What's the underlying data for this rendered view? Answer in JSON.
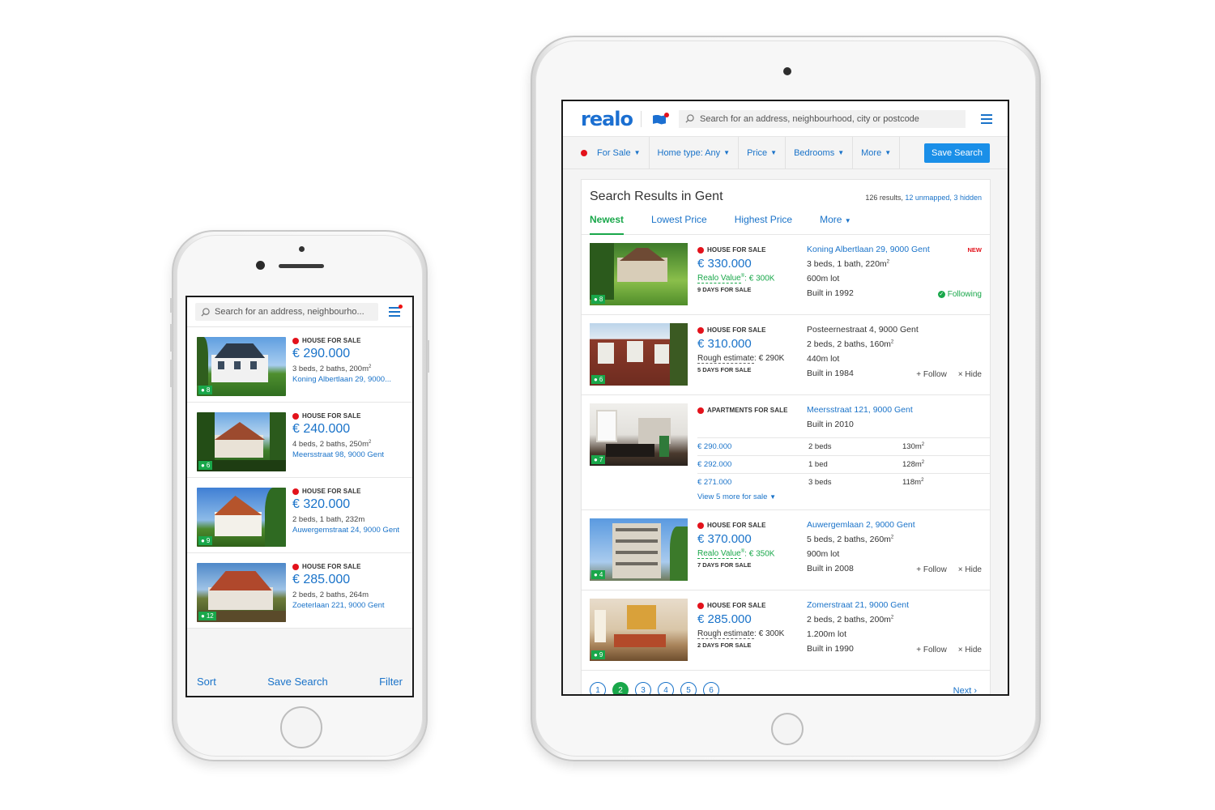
{
  "colors": {
    "brand": "#1a73c9",
    "green": "#19a74a",
    "red": "#e3121b"
  },
  "phone": {
    "search_placeholder": "Search for an address, neighbourho...",
    "listings": [
      {
        "type": "HOUSE FOR SALE",
        "price": "€ 290.000",
        "meta": "3 beds, 2 baths, 200m",
        "address": "Koning Albertlaan 29, 9000...",
        "photos": "8"
      },
      {
        "type": "HOUSE FOR SALE",
        "price": "€ 240.000",
        "meta": "4 beds, 2 baths, 250m",
        "address": "Meersstraat 98, 9000 Gent",
        "photos": "6"
      },
      {
        "type": "HOUSE FOR SALE",
        "price": "€ 320.000",
        "meta": "2 beds, 1 bath, 232m",
        "address": "Auwergemstraat 24, 9000 Gent",
        "photos": "9"
      },
      {
        "type": "HOUSE FOR SALE",
        "price": "€ 285.000",
        "meta": "2 beds, 2 baths, 264m",
        "address": "Zoeterlaan 221, 9000 Gent",
        "photos": "12"
      }
    ],
    "bottom": {
      "sort": "Sort",
      "save": "Save Search",
      "filter": "Filter"
    }
  },
  "tablet": {
    "logo": "realo",
    "search_placeholder": "Search for an address, neighbourhood, city or postcode",
    "filters": {
      "for_sale": "For Sale",
      "home_type": "Home type: Any",
      "price": "Price",
      "bedrooms": "Bedrooms",
      "more": "More"
    },
    "save_search": "Save Search",
    "title": "Search Results in Gent",
    "count": {
      "results": "126 results,",
      "unmapped": "12 unmapped,",
      "hidden": "3 hidden"
    },
    "tabs": {
      "newest": "Newest",
      "lowest": "Lowest Price",
      "highest": "Highest Price",
      "more": "More"
    },
    "listings": [
      {
        "type": "HOUSE FOR SALE",
        "price": "€ 330.000",
        "value_label": "Realo Value",
        "value_rest": ": € 300K",
        "days": "9 DAYS FOR SALE",
        "address": "Koning Albertlaan 29, 9000 Gent",
        "l1": "3 beds, 1 bath, 220m",
        "l2": "600m lot",
        "l3": "Built in 1992",
        "badge": "NEW",
        "following": "Following",
        "photos": "8"
      },
      {
        "type": "HOUSE FOR SALE",
        "price": "€ 310.000",
        "value_label": "Rough estimate",
        "value_rest": ": € 290K",
        "days": "5 DAYS FOR SALE",
        "address": "Posteernestraat 4, 9000 Gent",
        "l1": "2 beds, 2 baths, 160m",
        "l2": "440m lot",
        "l3": "Built in 1984",
        "follow": "Follow",
        "hide": "Hide",
        "photos": "6"
      },
      {
        "type": "HOUSE FOR SALE",
        "price": "€ 370.000",
        "value_label": "Realo Value",
        "value_rest": ": € 350K",
        "days": "7 DAYS FOR SALE",
        "address": "Auwergemlaan 2, 9000 Gent",
        "l1": "5 beds, 2 baths, 260m",
        "l2": "900m lot",
        "l3": "Built in 2008",
        "follow": "Follow",
        "hide": "Hide",
        "photos": "4"
      },
      {
        "type": "HOUSE FOR SALE",
        "price": "€ 285.000",
        "value_label": "Rough estimate",
        "value_rest": ": € 300K",
        "days": "2 DAYS FOR SALE",
        "address": "Zomerstraat 21, 9000 Gent",
        "l1": "2 beds, 2 baths, 200m",
        "l2": "1.200m lot",
        "l3": "Built in 1990",
        "follow": "Follow",
        "hide": "Hide",
        "photos": "9"
      }
    ],
    "apartment": {
      "type": "APARTMENTS FOR SALE",
      "address": "Meersstraat 121, 9000 Gent",
      "built": "Built in 2010",
      "photos": "7",
      "units": [
        {
          "price": "€ 290.000",
          "beds": "2 beds",
          "area": "130m"
        },
        {
          "price": "€ 292.000",
          "beds": "1 bed",
          "area": "128m"
        },
        {
          "price": "€ 271.000",
          "beds": "3 beds",
          "area": "118m"
        }
      ],
      "view_more": "View 5 more for sale"
    },
    "pages": [
      "1",
      "2",
      "3",
      "4",
      "5",
      "6"
    ],
    "next": "Next"
  }
}
